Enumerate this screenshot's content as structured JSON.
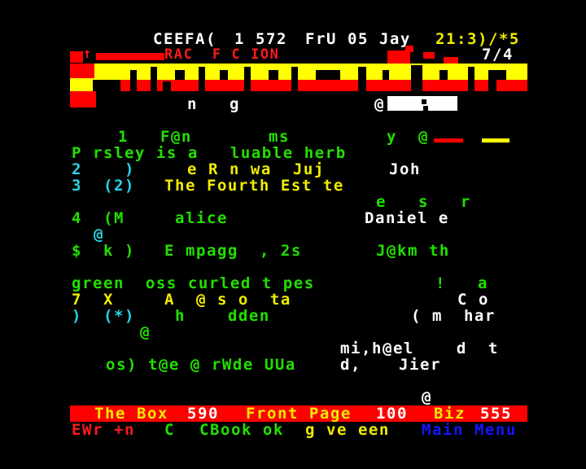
{
  "header": {
    "service": "CEEFA(",
    "page_number": "1 572",
    "date": "FrU 05 Jay",
    "time": "21:3)/*5"
  },
  "banner": {
    "title_fragment": "RAC  F C ION",
    "subpage": "7/4",
    "arrow_glyph": "↑"
  },
  "subheader": {
    "text": "n   g",
    "marker": "@"
  },
  "results": [
    {
      "left": "1   F@n",
      "mid": "ms",
      "right": "y  @"
    },
    {
      "text": "P rsley is a   luable herb"
    },
    {
      "num": "2    )",
      "mid": "e R n wa  Juj",
      "right": "Joh"
    },
    {
      "num": "3  (2)",
      "mid": "The Fourth Est te"
    },
    {
      "right": "e   s   r"
    },
    {
      "num": "4  (M",
      "mid": "alice",
      "right": "Daniel e"
    },
    {
      "marker": "@"
    },
    {
      "num": "$  k )",
      "mid": "E mpagg  , 2s",
      "right": "J@km th"
    },
    {
      "text": "green  oss curled t pes",
      "right": "!   a"
    },
    {
      "num": "7  X",
      "mid": "A  @ s o  ta",
      "right": "C o"
    },
    {
      "num": ")  (*)",
      "mid": "h    dden",
      "right": "( m  har"
    },
    {
      "marker": "@"
    },
    {
      "right": "mi,h@el    d  t"
    },
    {
      "text": "os) t@e @ rWde UUa",
      "mid": "d,",
      "right": "Jier"
    },
    {
      "marker": "@"
    }
  ],
  "footer": {
    "promo": {
      "box_label": "The Box",
      "box_page": "590",
      "front_label": "Front Page",
      "front_page": "100",
      "biz_label": "Biz",
      "biz_page": "555"
    },
    "fastext": {
      "red": "EWr +n",
      "green": "C",
      "green2": "CBook ok",
      "yellow": "g ve een",
      "blue": "Main Menu"
    }
  },
  "colors": {
    "background": "#000000",
    "teletext_red": "#ff0000",
    "teletext_yellow": "#ffff00",
    "teletext_green": "#22e000",
    "teletext_cyan": "#27d3e8",
    "teletext_blue": "#1414ff",
    "teletext_white": "#ffffff"
  }
}
